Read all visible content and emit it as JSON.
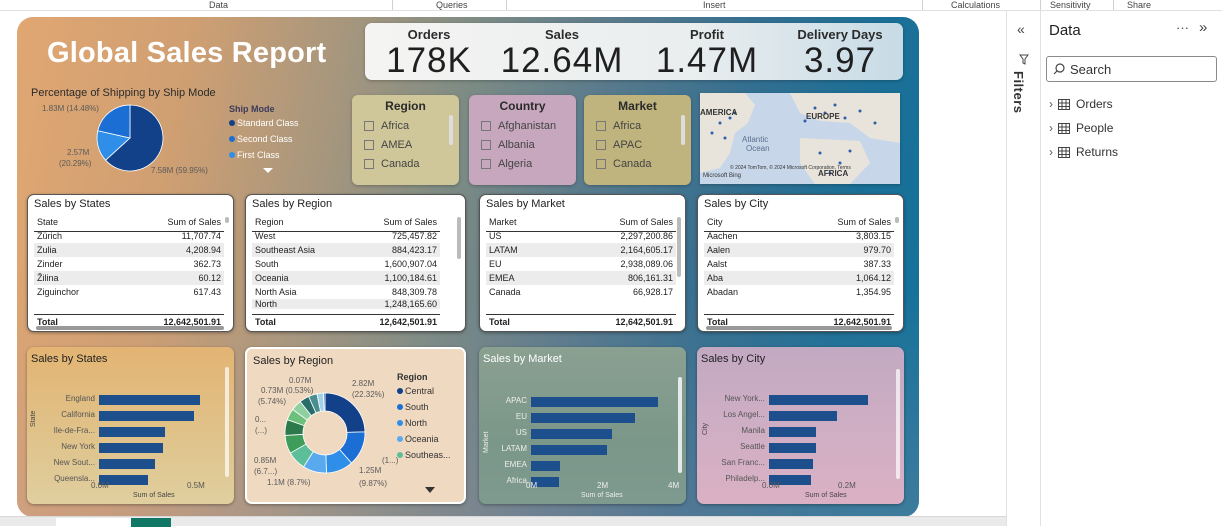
{
  "ribbon": {
    "groups": [
      "Data",
      "Queries",
      "Insert",
      "Calculations",
      "Sensitivity",
      "Share"
    ]
  },
  "report": {
    "title": "Global Sales Report"
  },
  "kpis": [
    {
      "label": "Orders",
      "value": "178K"
    },
    {
      "label": "Sales",
      "value": "12.64M"
    },
    {
      "label": "Profit",
      "value": "1.47M"
    },
    {
      "label": "Delivery Days",
      "value": "3.97"
    }
  ],
  "shipping": {
    "title": "Percentage of Shipping by Ship Mode",
    "legend_title": "Ship Mode",
    "legend": [
      "Standard Class",
      "Second Class",
      "First Class"
    ],
    "labels": [
      "1.83M (14.48%)",
      "2.57M",
      "(20.29%)",
      "7.58M (59.95%)"
    ]
  },
  "slicers": {
    "region": {
      "title": "Region",
      "items": [
        "Africa",
        "AMEA",
        "Canada"
      ]
    },
    "country": {
      "title": "Country",
      "items": [
        "Afghanistan",
        "Albania",
        "Algeria"
      ]
    },
    "market": {
      "title": "Market",
      "items": [
        "Africa",
        "APAC",
        "Canada"
      ]
    }
  },
  "map": {
    "labels": [
      "AMERICA",
      "EUROPE",
      "Atlantic",
      "Ocean",
      "AFRICA"
    ],
    "attribution": "© 2024 TomTom, © 2024 Microsoft Corporation, Terms",
    "brand": "Microsoft Bing"
  },
  "tables": {
    "states": {
      "title": "Sales by States",
      "col1": "State",
      "col2": "Sum of Sales",
      "rows": [
        [
          "Zürich",
          "11,707.74"
        ],
        [
          "Zulia",
          "4,208.94"
        ],
        [
          "Zinder",
          "362.73"
        ],
        [
          "Žilina",
          "60.12"
        ],
        [
          "Ziguinchor",
          "617.43"
        ]
      ],
      "total_label": "Total",
      "total": "12,642,501.91"
    },
    "region": {
      "title": "Sales by Region",
      "col1": "Region",
      "col2": "Sum of Sales",
      "rows": [
        [
          "West",
          "725,457.82"
        ],
        [
          "Southeast Asia",
          "884,423.17"
        ],
        [
          "South",
          "1,600,907.04"
        ],
        [
          "Oceania",
          "1,100,184.61"
        ],
        [
          "North Asia",
          "848,309.78"
        ],
        [
          "North",
          "1,248,165.60"
        ]
      ],
      "total_label": "Total",
      "total": "12,642,501.91"
    },
    "market": {
      "title": "Sales by Market",
      "col1": "Market",
      "col2": "Sum of Sales",
      "rows": [
        [
          "US",
          "2,297,200.86"
        ],
        [
          "LATAM",
          "2,164,605.17"
        ],
        [
          "EU",
          "2,938,089.06"
        ],
        [
          "EMEA",
          "806,161.31"
        ],
        [
          "Canada",
          "66,928.17"
        ]
      ],
      "total_label": "Total",
      "total": "12,642,501.91"
    },
    "city": {
      "title": "Sales by City",
      "col1": "City",
      "col2": "Sum of Sales",
      "rows": [
        [
          "Aachen",
          "3,803.15"
        ],
        [
          "Aalen",
          "979.70"
        ],
        [
          "Aalst",
          "387.33"
        ],
        [
          "Aba",
          "1,064.12"
        ],
        [
          "Abadan",
          "1,354.95"
        ]
      ],
      "total_label": "Total",
      "total": "12,642,501.91"
    }
  },
  "bar_states": {
    "title": "Sales by States",
    "categories": [
      "England",
      "California",
      "Ile-de-Fra...",
      "New York",
      "New Sout...",
      "Queensla..."
    ],
    "values": [
      0.485,
      0.457,
      0.318,
      0.308,
      0.271,
      0.238
    ],
    "ticks": [
      "0.0M",
      "0.5M"
    ],
    "xlabel": "Sum of Sales",
    "ylabel": "State"
  },
  "bar_market": {
    "title": "Sales by Market",
    "categories": [
      "APAC",
      "EU",
      "US",
      "LATAM",
      "EMEA",
      "Africa"
    ],
    "values": [
      3.59,
      2.94,
      2.3,
      2.16,
      0.81,
      0.78
    ],
    "ticks": [
      "0M",
      "2M",
      "4M"
    ],
    "xlabel": "Sum of Sales",
    "ylabel": "Market"
  },
  "bar_city": {
    "title": "Sales by City",
    "categories": [
      "New York...",
      "Los Angel...",
      "Manila",
      "Seattle",
      "San Franc...",
      "Philadelp..."
    ],
    "values": [
      0.256,
      0.176,
      0.12,
      0.12,
      0.112,
      0.109
    ],
    "ticks": [
      "0.0M",
      "0.2M"
    ],
    "xlabel": "Sum of Sales",
    "ylabel": "City"
  },
  "donut": {
    "title": "Sales by Region",
    "legend_title": "Region",
    "legend": [
      "Central",
      "South",
      "North",
      "Oceania",
      "Southeas..."
    ],
    "labels": [
      "0.07M",
      "0.73M (0.53%)",
      "(5.74%)",
      "2.82M",
      "(22.32%)",
      "0...",
      "(...)",
      "0.85M",
      "(6.7...)",
      "1.1M (8.7%)",
      "1.25M",
      "(9.87%)",
      "(1...)"
    ]
  },
  "chart_data": [
    {
      "type": "pie",
      "title": "Percentage of Shipping by Ship Mode",
      "categories": [
        "Standard Class",
        "Second Class",
        "First Class"
      ],
      "values": [
        7.58,
        2.57,
        1.83
      ],
      "value_unit": "M",
      "percentages": [
        59.95,
        20.29,
        14.48
      ]
    },
    {
      "type": "bar",
      "title": "Sales by States",
      "categories": [
        "England",
        "California",
        "Ile-de-Fra...",
        "New York",
        "New Sout...",
        "Queensla..."
      ],
      "values": [
        0.485,
        0.457,
        0.318,
        0.308,
        0.271,
        0.238
      ],
      "value_unit": "M",
      "xlim": [
        0,
        0.6
      ],
      "xlabel": "Sum of Sales",
      "ylabel": "State"
    },
    {
      "type": "pie",
      "title": "Sales by Region",
      "categories": [
        "Central",
        "South",
        "North",
        "Oceania",
        "Southeas..."
      ],
      "values": [
        2.82,
        1.6,
        1.25,
        1.1,
        0.88
      ],
      "value_unit": "M"
    },
    {
      "type": "bar",
      "title": "Sales by Market",
      "categories": [
        "APAC",
        "EU",
        "US",
        "LATAM",
        "EMEA",
        "Africa"
      ],
      "values": [
        3.59,
        2.94,
        2.3,
        2.16,
        0.81,
        0.78
      ],
      "value_unit": "M",
      "xlim": [
        0,
        4.5
      ],
      "xlabel": "Sum of Sales",
      "ylabel": "Market"
    },
    {
      "type": "bar",
      "title": "Sales by City",
      "categories": [
        "New York...",
        "Los Angel...",
        "Manila",
        "Seattle",
        "San Franc...",
        "Philadelp..."
      ],
      "values": [
        0.256,
        0.176,
        0.12,
        0.12,
        0.112,
        0.109
      ],
      "value_unit": "M",
      "xlim": [
        0,
        0.3
      ],
      "xlabel": "Sum of Sales",
      "ylabel": "City"
    }
  ],
  "panes": {
    "filters_label": "Filters",
    "data_title": "Data",
    "more": "···",
    "search_placeholder": "Search",
    "tables": [
      "Orders",
      "People",
      "Returns"
    ]
  }
}
